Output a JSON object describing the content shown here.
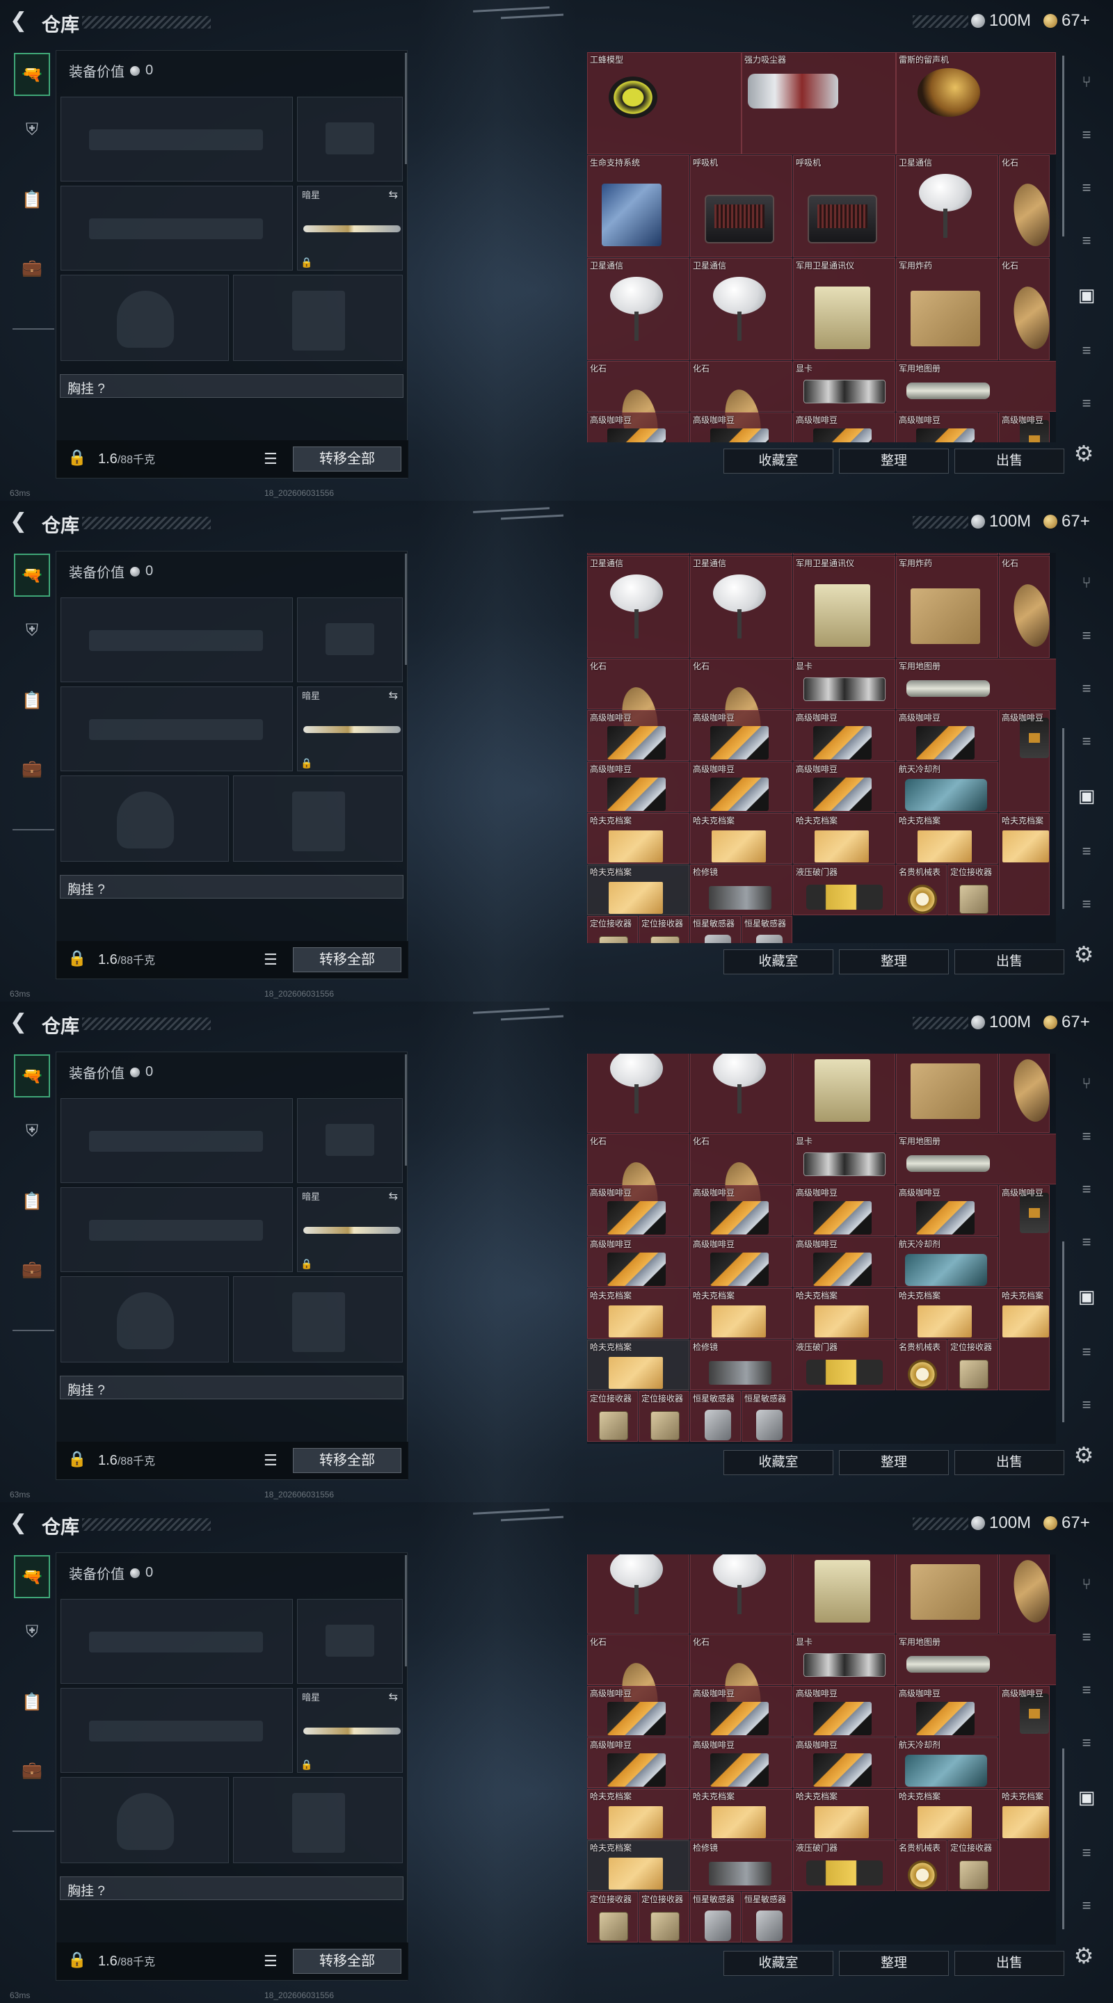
{
  "header": {
    "title": "仓库",
    "currency_silver": "100M",
    "currency_gold": "67+"
  },
  "loadout": {
    "equipment_value_label": "装备价值",
    "equipment_value": "0",
    "melee_label": "暗星",
    "chest_rig_label": "胸挂 ?",
    "weight_current": "1.6",
    "weight_max": "/88千克",
    "transfer_all_label": "转移全部"
  },
  "actions": {
    "collection_label": "收藏室",
    "sort_label": "整理",
    "sell_label": "出售"
  },
  "status": {
    "ping": "63ms",
    "build_id": "18_202606031556"
  },
  "storage": {
    "cells": [
      {
        "name": "工蜂模型",
        "row": 0,
        "col": 0,
        "art": "bee"
      },
      {
        "name": "强力吸尘器",
        "row": 0,
        "col": 1,
        "art": "vac"
      },
      {
        "name": "雷斯的留声机",
        "row": 0,
        "col": 2,
        "art": "gramo"
      },
      {
        "name": "",
        "row": 0,
        "col": 3,
        "art": ""
      },
      {
        "name": "",
        "row": 0,
        "col": 4,
        "art": ""
      },
      {
        "name": "",
        "row": 0,
        "col": 5,
        "art": ""
      },
      {
        "name": "",
        "row": 0,
        "col": 6,
        "art": ""
      },
      {
        "name": "",
        "row": 0,
        "col": 7,
        "art": ""
      },
      {
        "name": "",
        "row": 1,
        "col": 0,
        "art": ""
      },
      {
        "name": "",
        "row": 1,
        "col": 1,
        "art": ""
      },
      {
        "name": "",
        "row": 1,
        "col": 2,
        "art": ""
      },
      {
        "name": "",
        "row": 1,
        "col": 3,
        "art": ""
      },
      {
        "name": "",
        "row": 1,
        "col": 4,
        "art": ""
      },
      {
        "name": "",
        "row": 1,
        "col": 5,
        "art": ""
      },
      {
        "name": "",
        "row": 1,
        "col": 6,
        "art": ""
      },
      {
        "name": "",
        "row": 1,
        "col": 7,
        "art": ""
      },
      {
        "name": "生命支持系统",
        "row": 2,
        "col": 0,
        "art": "server"
      },
      {
        "name": "呼吸机",
        "row": 2,
        "col": 1,
        "art": "radio"
      },
      {
        "name": "呼吸机",
        "row": 2,
        "col": 2,
        "art": "radio"
      },
      {
        "name": "卫星通信",
        "row": 2,
        "col": 3,
        "art": "dish"
      },
      {
        "name": "化石",
        "row": 2,
        "col": 4,
        "art": "fossil"
      },
      {
        "name": "卫星通信",
        "row": 4,
        "col": 0,
        "art": "dish"
      },
      {
        "name": "卫星通信",
        "row": 4,
        "col": 1,
        "art": "dish"
      },
      {
        "name": "军用卫星通讯仪",
        "row": 4,
        "col": 2,
        "art": "antenna"
      },
      {
        "name": "军用炸药",
        "row": 4,
        "col": 3,
        "art": "crate"
      },
      {
        "name": "化石",
        "row": 4,
        "col": 4,
        "art": "fossil"
      },
      {
        "name": "化石",
        "row": 6,
        "col": 0,
        "art": "fossil"
      },
      {
        "name": "化石",
        "row": 6,
        "col": 1,
        "art": "fossil"
      },
      {
        "name": "显卡",
        "row": 6,
        "col": 2,
        "art": "gpu"
      },
      {
        "name": "军用地图册",
        "row": 6,
        "col": 3,
        "art": "tube"
      },
      {
        "name": "高级咖啡豆",
        "row": 7,
        "col": 0,
        "art": "coffee"
      },
      {
        "name": "高级咖啡豆",
        "row": 7,
        "col": 1,
        "art": "coffee"
      },
      {
        "name": "高级咖啡豆",
        "row": 7,
        "col": 2,
        "art": "coffee"
      },
      {
        "name": "高级咖啡豆",
        "row": 7,
        "col": 3,
        "art": "coffee"
      },
      {
        "name": "高级咖啡豆",
        "row": 7,
        "col": 4,
        "art": "bag"
      },
      {
        "name": "高级咖啡豆",
        "row": 8,
        "col": 0,
        "art": "coffee"
      },
      {
        "name": "高级咖啡豆",
        "row": 8,
        "col": 1,
        "art": "coffee"
      },
      {
        "name": "高级咖啡豆",
        "row": 8,
        "col": 2,
        "art": "coffee"
      },
      {
        "name": "航天冷却剂",
        "row": 8,
        "col": 3,
        "art": "cooler"
      },
      {
        "name": "哈夫克档案",
        "row": 9,
        "col": 0,
        "art": "folder"
      },
      {
        "name": "哈夫克档案",
        "row": 9,
        "col": 1,
        "art": "folder"
      },
      {
        "name": "哈夫克档案",
        "row": 9,
        "col": 2,
        "art": "folder"
      },
      {
        "name": "哈夫克档案",
        "row": 9,
        "col": 3,
        "art": "folder"
      },
      {
        "name": "哈夫克档案",
        "row": 9,
        "col": 4,
        "art": "folder"
      },
      {
        "name": "哈夫克档案",
        "row": 10,
        "col": 0,
        "art": "folder"
      },
      {
        "name": "检修镜",
        "row": 10,
        "col": 1,
        "art": "tool"
      },
      {
        "name": "液压破门器",
        "row": 10,
        "col": 2,
        "art": "breach"
      },
      {
        "name": "名贵机械表",
        "row": 10,
        "col": 3,
        "art": "watch"
      },
      {
        "name": "定位接收器",
        "row": 10,
        "col": 4,
        "art": "locator"
      },
      {
        "name": "定位接收器",
        "row": 11,
        "col": 0,
        "art": "locator"
      },
      {
        "name": "定位接收器",
        "row": 11,
        "col": 1,
        "art": "locator"
      },
      {
        "name": "恒星敏感器",
        "row": 11,
        "col": 2,
        "art": "sensor"
      },
      {
        "name": "恒星敏感器",
        "row": 11,
        "col": 3,
        "art": "sensor"
      }
    ]
  }
}
